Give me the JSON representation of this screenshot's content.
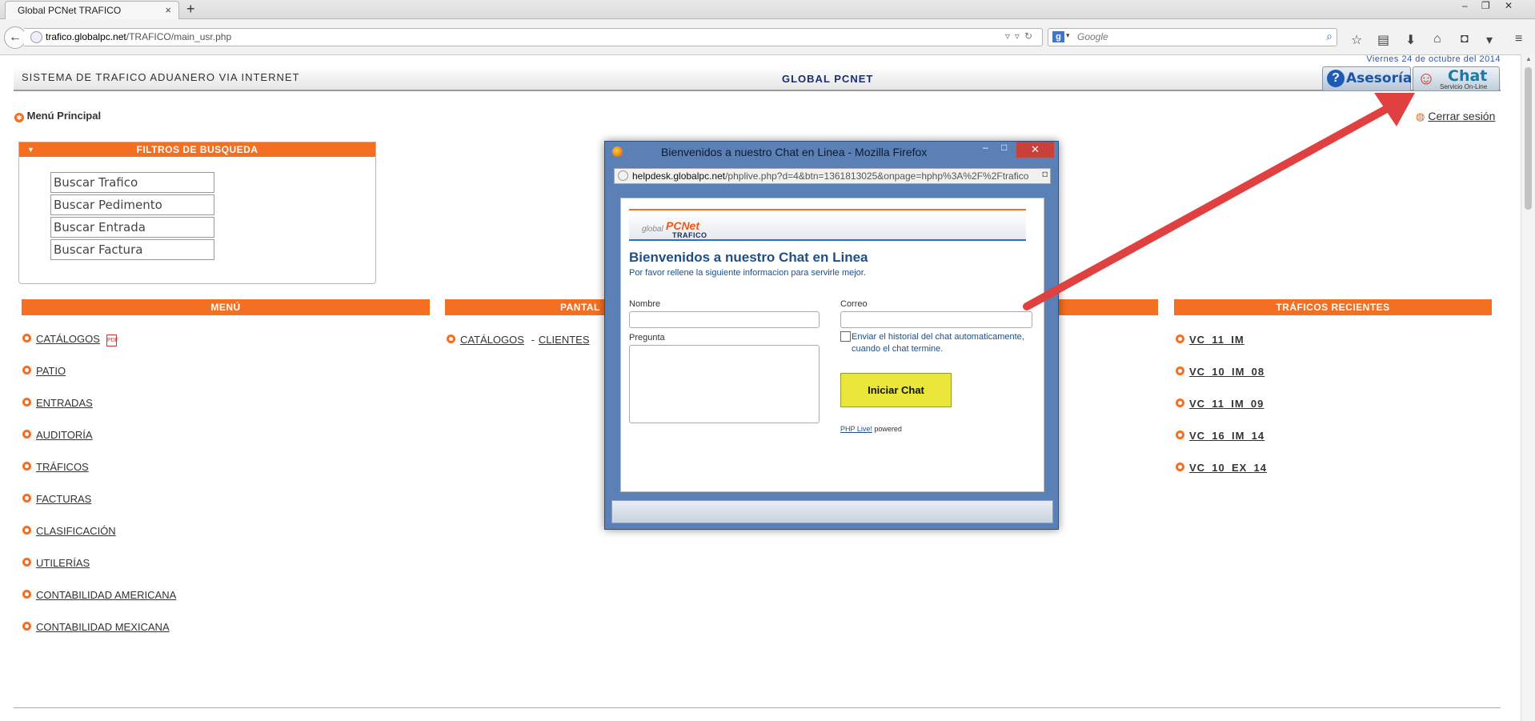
{
  "browser": {
    "tab_title": "Global PCNet TRAFICO",
    "tab_close": "×",
    "new_tab": "+",
    "url_host": "trafico.globalpc.net",
    "url_path": "/TRAFICO/main_usr.php",
    "search_placeholder": "Google",
    "window_controls": [
      "–",
      "❐",
      "✕"
    ]
  },
  "header": {
    "system_title": "SISTEMA DE TRAFICO ADUANERO VIA INTERNET",
    "brand": "GLOBAL PCNET",
    "date": "Viernes 24 de octubre del 2014",
    "asesoria_label": "Asesoría",
    "chat_label": "Chat",
    "chat_sub": "Servicio On-Line"
  },
  "nav": {
    "menu_principal": "Menú Principal",
    "logout": "Cerrar sesión"
  },
  "filters": {
    "title": "FILTROS DE BUSQUEDA",
    "items": [
      "Buscar Trafico",
      "Buscar Pedimento",
      "Buscar Entrada",
      "Buscar Factura"
    ]
  },
  "menu": {
    "title": "MENÚ",
    "items": [
      "CATÁLOGOS",
      "PATIO",
      "ENTRADAS",
      "AUDITORÍA",
      "TRÁFICOS",
      "FACTURAS",
      "CLASIFICACIÓN",
      "UTILERÍAS",
      "CONTABILIDAD AMERICANA",
      "CONTABILIDAD MEXICANA"
    ]
  },
  "pantallas": {
    "title": "PANTAL",
    "link1": "CATÁLOGOS",
    "separator": "-",
    "link2": "CLIENTES"
  },
  "recientes": {
    "title": "TRÁFICOS RECIENTES",
    "items": [
      "VC_11_IM",
      "VC_10_IM_08",
      "VC_11_IM_09",
      "VC_16_IM_14",
      "VC_10_EX_14"
    ]
  },
  "popup": {
    "window_title": "Bienvenidos a nuestro Chat en Linea - Mozilla Firefox",
    "url_host": "helpdesk.globalpc.net",
    "url_path": "/phplive.php?d=4&btn=1361813025&onpage=hphp%3A%2F%2Ftrafico",
    "logo_small": "global",
    "logo_big": "PCNet",
    "logo_sub": "TRAFICO",
    "heading": "Bienvenidos a nuestro Chat en Linea",
    "subheading": "Por favor rellene la siguiente informacion para servirle mejor.",
    "label_nombre": "Nombre",
    "label_correo": "Correo",
    "label_pregunta": "Pregunta",
    "checkbox_text": "Enviar el historial del chat automaticamente, cuando el chat termine.",
    "button": "Iniciar Chat",
    "powered_link": "PHP Live!",
    "powered_text": "powered"
  },
  "colors": {
    "accent_orange": "#f36f21",
    "brand_blue": "#1b2f6b",
    "arrow_red": "#e04040"
  }
}
